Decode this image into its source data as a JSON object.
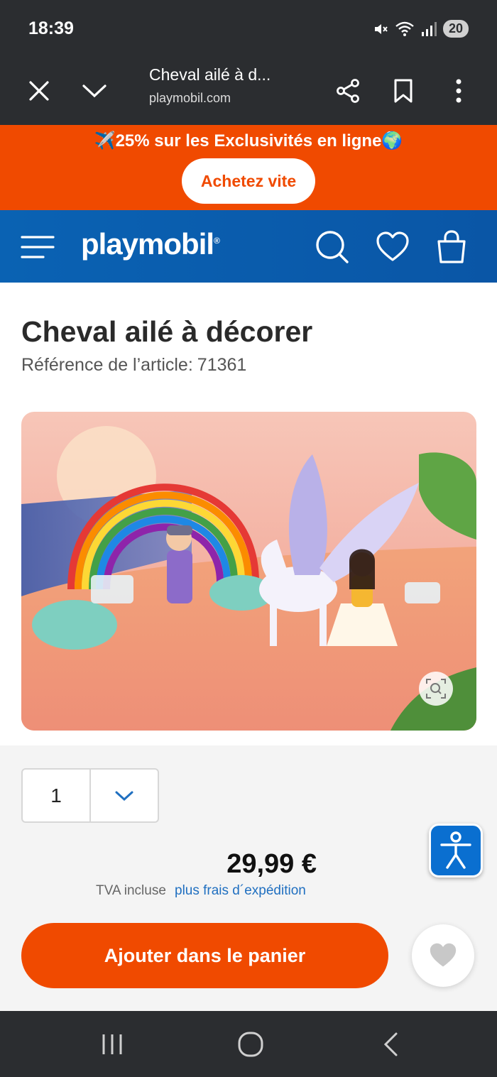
{
  "status_bar": {
    "time": "18:39",
    "battery": "20"
  },
  "browser": {
    "tab_title": "Cheval ailé à d...",
    "url": "playmobil.com"
  },
  "promo": {
    "text": "✈️25% sur les Exclusivités en ligne🌍",
    "button_label": "Achetez vite"
  },
  "header": {
    "logo_text": "playmobil",
    "logo_mark": "®"
  },
  "product": {
    "title": "Cheval ailé à décorer",
    "reference_label": "Référence de l’article:",
    "reference_number": "71361",
    "price": "29,99 €",
    "tva_label": "TVA incluse",
    "shipping_link": "plus frais d´expédition",
    "quantity": "1",
    "add_to_cart_label": "Ajouter dans le panier"
  },
  "colors": {
    "brand_orange": "#f04a00",
    "brand_blue": "#0a62b3",
    "dark_bar": "#2b2d30",
    "link_blue": "#1f6fc0"
  },
  "icons": {
    "browser": [
      "close-icon",
      "chevron-down-icon",
      "share-icon",
      "bookmark-icon",
      "more-vert-icon"
    ],
    "header": [
      "menu-icon",
      "search-icon",
      "heart-icon",
      "shopping-bag-icon"
    ],
    "nav": [
      "recent-apps-icon",
      "home-icon",
      "back-icon"
    ]
  }
}
